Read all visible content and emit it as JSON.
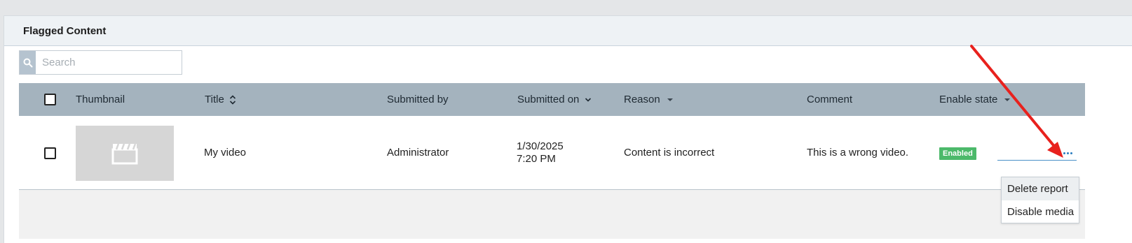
{
  "panel": {
    "title": "Flagged Content"
  },
  "search": {
    "placeholder": "Search",
    "value": ""
  },
  "table": {
    "columns": {
      "thumbnail": "Thumbnail",
      "title": "Title",
      "submitted_by": "Submitted by",
      "submitted_on": "Submitted on",
      "reason": "Reason",
      "comment": "Comment",
      "enable_state": "Enable state"
    },
    "rows": [
      {
        "title": "My video",
        "submitted_by": "Administrator",
        "submitted_on_date": "1/30/2025",
        "submitted_on_time": "7:20 PM",
        "reason": "Content is incorrect",
        "comment": "This is a wrong video.",
        "enable_state": "Enabled"
      }
    ]
  },
  "row_menu": {
    "items": [
      "Delete report",
      "Disable media"
    ]
  },
  "colors": {
    "header_bg": "#a4b3be",
    "enabled_badge": "#4cb96a",
    "annotation_arrow": "#e8211d"
  }
}
